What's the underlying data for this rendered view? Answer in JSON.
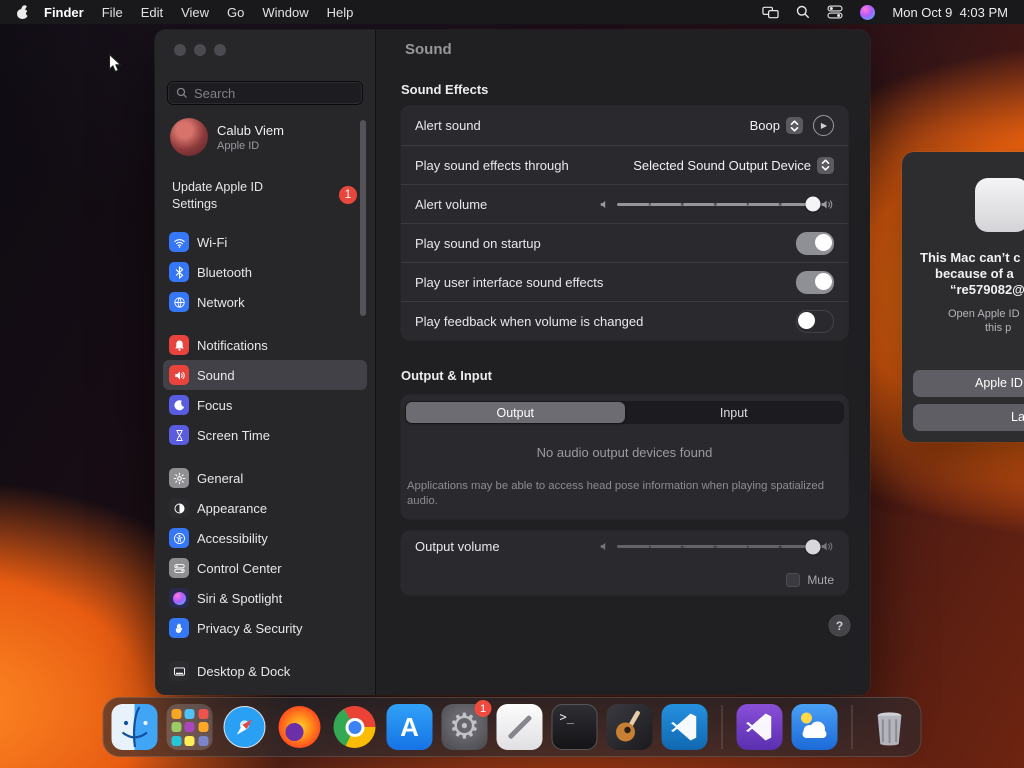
{
  "menu_bar": {
    "app_name": "Finder",
    "items": [
      "File",
      "Edit",
      "View",
      "Go",
      "Window",
      "Help"
    ],
    "status_icons": [
      "displays-icon",
      "spotlight-search-icon",
      "control-center-icon",
      "siri-icon"
    ],
    "clock": "Mon Oct 9  4:03 PM"
  },
  "window": {
    "sidebar": {
      "search_placeholder": "Search",
      "profile": {
        "name": "Calub Viem",
        "subtitle": "Apple ID"
      },
      "update_notice": {
        "line1": "Update Apple ID",
        "line2": "Settings",
        "badge": "1"
      },
      "groups": [
        [
          {
            "label": "Wi-Fi",
            "icon": "wifi",
            "color": "#3577f6"
          },
          {
            "label": "Bluetooth",
            "icon": "bluetooth",
            "color": "#3577f6"
          },
          {
            "label": "Network",
            "icon": "globe",
            "color": "#3577f6"
          }
        ],
        [
          {
            "label": "Notifications",
            "icon": "bell",
            "color": "#e8433c"
          },
          {
            "label": "Sound",
            "icon": "speaker",
            "color": "#e8433c",
            "selected": true
          },
          {
            "label": "Focus",
            "icon": "moon",
            "color": "#5a5ce0"
          },
          {
            "label": "Screen Time",
            "icon": "hourglass",
            "color": "#5a5ce0"
          }
        ],
        [
          {
            "label": "General",
            "icon": "gear",
            "color": "#8e8e93"
          },
          {
            "label": "Appearance",
            "icon": "appearance",
            "color": "#2c2c30"
          },
          {
            "label": "Accessibility",
            "icon": "accessibility",
            "color": "#3577f6"
          },
          {
            "label": "Control Center",
            "icon": "toggles",
            "color": "#8e8e93"
          },
          {
            "label": "Siri & Spotlight",
            "icon": "siri",
            "color": "#2a2a4e"
          },
          {
            "label": "Privacy & Security",
            "icon": "hand",
            "color": "#3577f6"
          }
        ],
        [
          {
            "label": "Desktop & Dock",
            "icon": "dock",
            "color": "#2c2c30"
          }
        ]
      ]
    },
    "main": {
      "title": "Sound",
      "sound_effects": {
        "heading": "Sound Effects",
        "alert_sound_label": "Alert sound",
        "alert_sound_value": "Boop",
        "play_through_label": "Play sound effects through",
        "play_through_value": "Selected Sound Output Device",
        "alert_volume_label": "Alert volume",
        "alert_volume_percent": 100,
        "toggles": [
          {
            "label": "Play sound on startup",
            "on": true
          },
          {
            "label": "Play user interface sound effects",
            "on": true
          },
          {
            "label": "Play feedback when volume is changed",
            "on": false
          }
        ]
      },
      "output_input": {
        "heading": "Output & Input",
        "tabs": [
          "Output",
          "Input"
        ],
        "selected_tab": "Output",
        "empty_message": "No audio output devices found",
        "footnote": "Applications may be able to access head pose information when playing spatialized audio."
      },
      "output_volume": {
        "label": "Output volume",
        "percent": 100,
        "mute_label": "Mute",
        "muted": false
      },
      "help_label": "?"
    }
  },
  "dialog": {
    "title_lines": [
      "This Mac can’t c",
      "because of a",
      "“re579082@"
    ],
    "body_lines": [
      "Open Apple ID",
      "this p"
    ],
    "primary_button": "Apple ID",
    "secondary_button": "La"
  },
  "dock": {
    "items": [
      {
        "name": "finder"
      },
      {
        "name": "launchpad"
      },
      {
        "name": "safari"
      },
      {
        "name": "firefox"
      },
      {
        "name": "chrome"
      },
      {
        "name": "app-store"
      },
      {
        "name": "system-settings",
        "badge": "1"
      },
      {
        "name": "notes"
      },
      {
        "name": "terminal"
      },
      {
        "name": "garageband"
      },
      {
        "name": "vscode"
      },
      {
        "type": "divider"
      },
      {
        "name": "vscode-insiders"
      },
      {
        "name": "weather"
      },
      {
        "type": "divider"
      },
      {
        "name": "trash"
      }
    ]
  }
}
